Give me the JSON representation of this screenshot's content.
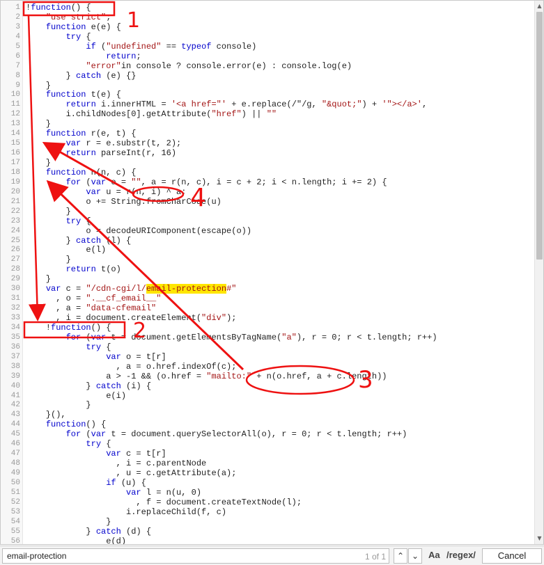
{
  "code_lines": [
    {
      "n": "1",
      "segs": [
        {
          "t": "!",
          "c": ""
        },
        {
          "t": "function",
          "c": "kw"
        },
        {
          "t": "() {",
          "c": ""
        }
      ]
    },
    {
      "n": "2",
      "segs": [
        {
          "t": "    ",
          "c": ""
        },
        {
          "t": "\"use strict\"",
          "c": "str"
        },
        {
          "t": ";",
          "c": ""
        }
      ]
    },
    {
      "n": "3",
      "segs": [
        {
          "t": "    ",
          "c": ""
        },
        {
          "t": "function",
          "c": "kw"
        },
        {
          "t": " e(e) {",
          "c": ""
        }
      ]
    },
    {
      "n": "4",
      "segs": [
        {
          "t": "        ",
          "c": ""
        },
        {
          "t": "try",
          "c": "kw"
        },
        {
          "t": " {",
          "c": ""
        }
      ]
    },
    {
      "n": "5",
      "segs": [
        {
          "t": "            ",
          "c": ""
        },
        {
          "t": "if",
          "c": "kw"
        },
        {
          "t": " (",
          "c": ""
        },
        {
          "t": "\"undefined\"",
          "c": "str"
        },
        {
          "t": " == ",
          "c": ""
        },
        {
          "t": "typeof",
          "c": "kw"
        },
        {
          "t": " console)",
          "c": ""
        }
      ]
    },
    {
      "n": "6",
      "segs": [
        {
          "t": "                ",
          "c": ""
        },
        {
          "t": "return",
          "c": "kw"
        },
        {
          "t": ";",
          "c": ""
        }
      ]
    },
    {
      "n": "7",
      "segs": [
        {
          "t": "            ",
          "c": ""
        },
        {
          "t": "\"error\"",
          "c": "str"
        },
        {
          "t": "in console ? console.error(e) : console.log(e)",
          "c": ""
        }
      ]
    },
    {
      "n": "8",
      "segs": [
        {
          "t": "        } ",
          "c": ""
        },
        {
          "t": "catch",
          "c": "kw"
        },
        {
          "t": " (e) {}",
          "c": ""
        }
      ]
    },
    {
      "n": "9",
      "segs": [
        {
          "t": "    }",
          "c": ""
        }
      ]
    },
    {
      "n": "10",
      "segs": [
        {
          "t": "    ",
          "c": ""
        },
        {
          "t": "function",
          "c": "kw"
        },
        {
          "t": " t(e) {",
          "c": ""
        }
      ]
    },
    {
      "n": "11",
      "segs": [
        {
          "t": "        ",
          "c": ""
        },
        {
          "t": "return",
          "c": "kw"
        },
        {
          "t": " i.innerHTML = ",
          "c": ""
        },
        {
          "t": "'<a href=\"'",
          "c": "str"
        },
        {
          "t": " + e.replace(/\"/g, ",
          "c": ""
        },
        {
          "t": "\"&quot;\"",
          "c": "str"
        },
        {
          "t": ") + ",
          "c": ""
        },
        {
          "t": "'\"></a>'",
          "c": "str"
        },
        {
          "t": ",",
          "c": ""
        }
      ]
    },
    {
      "n": "12",
      "segs": [
        {
          "t": "        i.childNodes[0].getAttribute(",
          "c": ""
        },
        {
          "t": "\"href\"",
          "c": "str"
        },
        {
          "t": ") || ",
          "c": ""
        },
        {
          "t": "\"\"",
          "c": "str"
        }
      ]
    },
    {
      "n": "13",
      "segs": [
        {
          "t": "    }",
          "c": ""
        }
      ]
    },
    {
      "n": "14",
      "segs": [
        {
          "t": "    ",
          "c": ""
        },
        {
          "t": "function",
          "c": "kw"
        },
        {
          "t": " r(e, t) {",
          "c": ""
        }
      ]
    },
    {
      "n": "15",
      "segs": [
        {
          "t": "        ",
          "c": ""
        },
        {
          "t": "var",
          "c": "kw"
        },
        {
          "t": " r = e.substr(t, 2);",
          "c": ""
        }
      ]
    },
    {
      "n": "16",
      "segs": [
        {
          "t": "        ",
          "c": ""
        },
        {
          "t": "return",
          "c": "kw"
        },
        {
          "t": " parseInt(r, 16)",
          "c": ""
        }
      ]
    },
    {
      "n": "17",
      "segs": [
        {
          "t": "    }",
          "c": ""
        }
      ]
    },
    {
      "n": "18",
      "segs": [
        {
          "t": "    ",
          "c": ""
        },
        {
          "t": "function",
          "c": "kw"
        },
        {
          "t": " n(n, c) {",
          "c": ""
        }
      ]
    },
    {
      "n": "19",
      "segs": [
        {
          "t": "        ",
          "c": ""
        },
        {
          "t": "for",
          "c": "kw"
        },
        {
          "t": " (",
          "c": ""
        },
        {
          "t": "var",
          "c": "kw"
        },
        {
          "t": " o = ",
          "c": ""
        },
        {
          "t": "\"\"",
          "c": "str"
        },
        {
          "t": ", a = r(n, c), i = c + 2; i < n.length; i += 2) {",
          "c": ""
        }
      ]
    },
    {
      "n": "20",
      "segs": [
        {
          "t": "            ",
          "c": ""
        },
        {
          "t": "var",
          "c": "kw"
        },
        {
          "t": " u = r(n, i) ^ a;",
          "c": ""
        }
      ]
    },
    {
      "n": "21",
      "segs": [
        {
          "t": "            o += String.fromCharCode(u)",
          "c": ""
        }
      ]
    },
    {
      "n": "22",
      "segs": [
        {
          "t": "        }",
          "c": ""
        }
      ]
    },
    {
      "n": "23",
      "segs": [
        {
          "t": "        ",
          "c": ""
        },
        {
          "t": "try",
          "c": "kw"
        },
        {
          "t": " {",
          "c": ""
        }
      ]
    },
    {
      "n": "24",
      "segs": [
        {
          "t": "            o = decodeURIComponent(escape(o))",
          "c": ""
        }
      ]
    },
    {
      "n": "25",
      "segs": [
        {
          "t": "        } ",
          "c": ""
        },
        {
          "t": "catch",
          "c": "kw"
        },
        {
          "t": " (l) {",
          "c": ""
        }
      ]
    },
    {
      "n": "26",
      "segs": [
        {
          "t": "            e(l)",
          "c": ""
        }
      ]
    },
    {
      "n": "27",
      "segs": [
        {
          "t": "        }",
          "c": ""
        }
      ]
    },
    {
      "n": "28",
      "segs": [
        {
          "t": "        ",
          "c": ""
        },
        {
          "t": "return",
          "c": "kw"
        },
        {
          "t": " t(o)",
          "c": ""
        }
      ]
    },
    {
      "n": "29",
      "segs": [
        {
          "t": "    }",
          "c": ""
        }
      ]
    },
    {
      "n": "30",
      "segs": [
        {
          "t": "    ",
          "c": ""
        },
        {
          "t": "var",
          "c": "kw"
        },
        {
          "t": " c = ",
          "c": ""
        },
        {
          "t": "\"/cdn-cgi/l/",
          "c": "str"
        },
        {
          "t": "email-protection",
          "c": "hl"
        },
        {
          "t": "#\"",
          "c": "str"
        }
      ]
    },
    {
      "n": "31",
      "segs": [
        {
          "t": "      , o = ",
          "c": ""
        },
        {
          "t": "\".__cf_email__\"",
          "c": "str"
        }
      ]
    },
    {
      "n": "32",
      "segs": [
        {
          "t": "      , a = ",
          "c": ""
        },
        {
          "t": "\"data-cfemail\"",
          "c": "str"
        }
      ]
    },
    {
      "n": "33",
      "segs": [
        {
          "t": "      , i = document.createElement(",
          "c": ""
        },
        {
          "t": "\"div\"",
          "c": "str"
        },
        {
          "t": ");",
          "c": ""
        }
      ]
    },
    {
      "n": "34",
      "segs": [
        {
          "t": "    !",
          "c": ""
        },
        {
          "t": "function",
          "c": "kw"
        },
        {
          "t": "() {",
          "c": ""
        }
      ]
    },
    {
      "n": "35",
      "segs": [
        {
          "t": "        ",
          "c": ""
        },
        {
          "t": "for",
          "c": "kw"
        },
        {
          "t": " (",
          "c": ""
        },
        {
          "t": "var",
          "c": "kw"
        },
        {
          "t": " t = document.getElementsByTagName(",
          "c": ""
        },
        {
          "t": "\"a\"",
          "c": "str"
        },
        {
          "t": "), r = 0; r < t.length; r++)",
          "c": ""
        }
      ]
    },
    {
      "n": "36",
      "segs": [
        {
          "t": "            ",
          "c": ""
        },
        {
          "t": "try",
          "c": "kw"
        },
        {
          "t": " {",
          "c": ""
        }
      ]
    },
    {
      "n": "37",
      "segs": [
        {
          "t": "                ",
          "c": ""
        },
        {
          "t": "var",
          "c": "kw"
        },
        {
          "t": " o = t[r]",
          "c": ""
        }
      ]
    },
    {
      "n": "38",
      "segs": [
        {
          "t": "                  , a = o.href.indexOf(c);",
          "c": ""
        }
      ]
    },
    {
      "n": "39",
      "segs": [
        {
          "t": "                a > -1 && (o.href = ",
          "c": ""
        },
        {
          "t": "\"mailto:\"",
          "c": "str"
        },
        {
          "t": " + n(o.href, a + c.length))",
          "c": ""
        }
      ]
    },
    {
      "n": "40",
      "segs": [
        {
          "t": "            } ",
          "c": ""
        },
        {
          "t": "catch",
          "c": "kw"
        },
        {
          "t": " (i) {",
          "c": ""
        }
      ]
    },
    {
      "n": "41",
      "segs": [
        {
          "t": "                e(i)",
          "c": ""
        }
      ]
    },
    {
      "n": "42",
      "segs": [
        {
          "t": "            }",
          "c": ""
        }
      ]
    },
    {
      "n": "43",
      "segs": [
        {
          "t": "    }(),",
          "c": ""
        }
      ]
    },
    {
      "n": "44",
      "segs": [
        {
          "t": "    ",
          "c": ""
        },
        {
          "t": "function",
          "c": "kw"
        },
        {
          "t": "() {",
          "c": ""
        }
      ]
    },
    {
      "n": "45",
      "segs": [
        {
          "t": "        ",
          "c": ""
        },
        {
          "t": "for",
          "c": "kw"
        },
        {
          "t": " (",
          "c": ""
        },
        {
          "t": "var",
          "c": "kw"
        },
        {
          "t": " t = document.querySelectorAll(o), r = 0; r < t.length; r++)",
          "c": ""
        }
      ]
    },
    {
      "n": "46",
      "segs": [
        {
          "t": "            ",
          "c": ""
        },
        {
          "t": "try",
          "c": "kw"
        },
        {
          "t": " {",
          "c": ""
        }
      ]
    },
    {
      "n": "47",
      "segs": [
        {
          "t": "                ",
          "c": ""
        },
        {
          "t": "var",
          "c": "kw"
        },
        {
          "t": " c = t[r]",
          "c": ""
        }
      ]
    },
    {
      "n": "48",
      "segs": [
        {
          "t": "                  , i = c.parentNode",
          "c": ""
        }
      ]
    },
    {
      "n": "49",
      "segs": [
        {
          "t": "                  , u = c.getAttribute(a);",
          "c": ""
        }
      ]
    },
    {
      "n": "50",
      "segs": [
        {
          "t": "                ",
          "c": ""
        },
        {
          "t": "if",
          "c": "kw"
        },
        {
          "t": " (u) {",
          "c": ""
        }
      ]
    },
    {
      "n": "51",
      "segs": [
        {
          "t": "                    ",
          "c": ""
        },
        {
          "t": "var",
          "c": "kw"
        },
        {
          "t": " l = n(u, 0)",
          "c": ""
        }
      ]
    },
    {
      "n": "52",
      "segs": [
        {
          "t": "                      , f = document.createTextNode(l);",
          "c": ""
        }
      ]
    },
    {
      "n": "53",
      "segs": [
        {
          "t": "                    i.replaceChild(f, c)",
          "c": ""
        }
      ]
    },
    {
      "n": "54",
      "segs": [
        {
          "t": "                }",
          "c": ""
        }
      ]
    },
    {
      "n": "55",
      "segs": [
        {
          "t": "            } ",
          "c": ""
        },
        {
          "t": "catch",
          "c": "kw"
        },
        {
          "t": " (d) {",
          "c": ""
        }
      ]
    },
    {
      "n": "56",
      "segs": [
        {
          "t": "                e(d)",
          "c": ""
        }
      ]
    }
  ],
  "annotations": {
    "label_1": "1",
    "label_2": "2",
    "label_3": "3",
    "label_4": "4",
    "color": "#ee1111"
  },
  "find_bar": {
    "query": "email-protection",
    "count": "1 of 1",
    "prev_icon": "chevron-up-icon",
    "next_icon": "chevron-down-icon",
    "match_case_label": "Aa",
    "regex_label": "/regex/",
    "cancel_label": "Cancel"
  }
}
